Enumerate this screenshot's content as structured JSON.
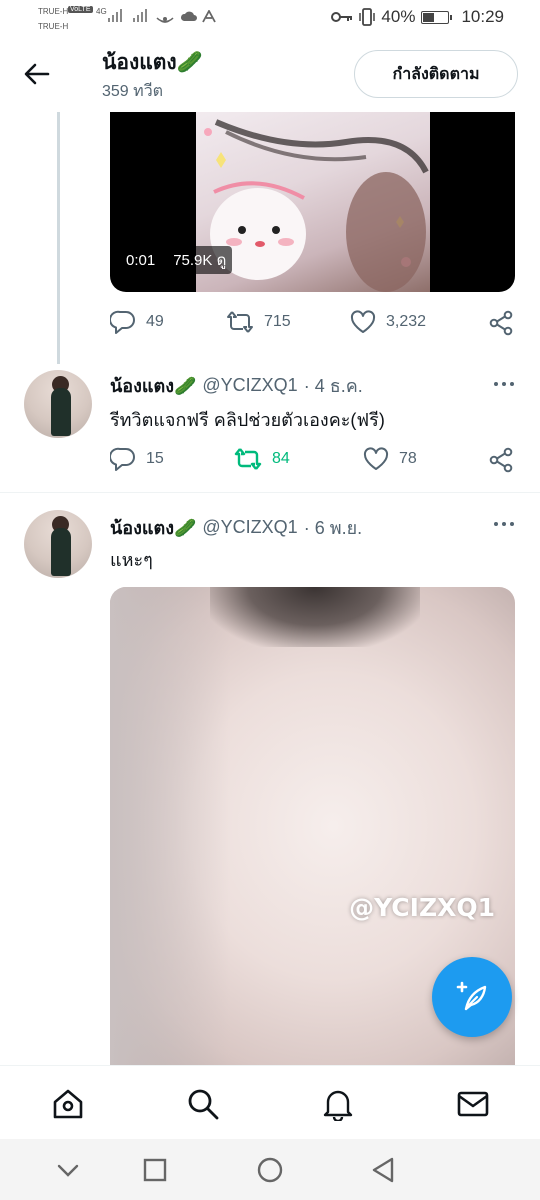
{
  "status_bar": {
    "carrier_1": "TRUE-H",
    "carrier_2": "TRUE-H",
    "volte": "VoLTE",
    "network": "4G",
    "battery": "40%",
    "time": "10:29"
  },
  "header": {
    "name": "น้องแตง🥒",
    "tweet_count": "359 ทวีต",
    "follow_label": "กำลังติดตาม"
  },
  "video_tweet": {
    "duration": "0:01",
    "views": "75.9K ดู",
    "replies": "49",
    "retweets": "715",
    "likes": "3,232"
  },
  "tweets": [
    {
      "name": "น้องแตง🥒",
      "handle": "@YCIZXQ1",
      "date": "· 4 ธ.ค.",
      "text": "รีทวิตแจกฟรี คลิปช่วยตัวเองคะ(ฟรี)",
      "replies": "15",
      "retweets": "84",
      "likes": "78",
      "retweeted": true
    },
    {
      "name": "น้องแตง🥒",
      "handle": "@YCIZXQ1",
      "date": "· 6 พ.ย.",
      "text": "แหะๆ",
      "watermark": "@YCIZXQ1"
    }
  ],
  "colors": {
    "accent": "#1d9bf0",
    "retweet_active": "#00ba7c",
    "secondary_text": "#536471"
  },
  "icons": {
    "back": "arrow-left-icon",
    "reply": "reply-icon",
    "retweet": "retweet-icon",
    "like": "heart-icon",
    "share": "share-icon",
    "more": "more-icon",
    "compose": "compose-icon",
    "home": "home-icon",
    "search": "search-icon",
    "notifications": "bell-icon",
    "messages": "mail-icon"
  }
}
